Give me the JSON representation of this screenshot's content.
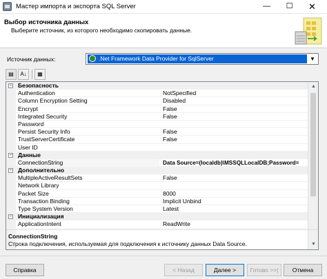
{
  "window": {
    "title": "Мастер импорта и экспорта SQL Server",
    "minimize": "—",
    "maximize": "☐",
    "close": "✕"
  },
  "header": {
    "title": "Выбор источника данных",
    "subtitle": "Выберите источник, из которого необходимо скопировать данные."
  },
  "datasource": {
    "label": "Источник данных:",
    "value": ".Net Framework Data Provider for SqlServer",
    "icon": "database-globe-icon"
  },
  "toolbar": {
    "categorized": "▤",
    "alphabetical": "A↓",
    "pages": "▦"
  },
  "categories": [
    {
      "name": "Безопасность",
      "toggle": "−",
      "props": [
        {
          "name": "Authentication",
          "value": "NotSpecified"
        },
        {
          "name": "Column Encryption Setting",
          "value": "Disabled"
        },
        {
          "name": "Encrypt",
          "value": "False"
        },
        {
          "name": "Integrated Security",
          "value": "False"
        },
        {
          "name": "Password",
          "value": ""
        },
        {
          "name": "Persist Security Info",
          "value": "False"
        },
        {
          "name": "TrustServerCertificate",
          "value": "False"
        },
        {
          "name": "User ID",
          "value": ""
        }
      ]
    },
    {
      "name": "Данные",
      "toggle": "−",
      "props": [
        {
          "name": "ConnectionString",
          "value": "Data Source=(localdb)\\MSSQLLocalDB;Password=",
          "bold": true,
          "selected": true
        }
      ]
    },
    {
      "name": "Дополнительно",
      "toggle": "−",
      "props": [
        {
          "name": "MultipleActiveResultSets",
          "value": "False"
        },
        {
          "name": "Network Library",
          "value": ""
        },
        {
          "name": "Packet Size",
          "value": "8000"
        },
        {
          "name": "Transaction Binding",
          "value": "Implicit Unbind"
        },
        {
          "name": "Type System Version",
          "value": "Latest"
        }
      ]
    },
    {
      "name": "Инициализация",
      "toggle": "−",
      "props": [
        {
          "name": "ApplicationIntent",
          "value": "ReadWrite"
        }
      ]
    }
  ],
  "description": {
    "title": "ConnectionString",
    "text": "Строка подключения, используемая для подключения к источнику данных Data Source."
  },
  "buttons": {
    "help": "Справка",
    "back": "< Назад",
    "next": "Далее >",
    "finish": "Готово >>|",
    "cancel": "Отмена"
  }
}
